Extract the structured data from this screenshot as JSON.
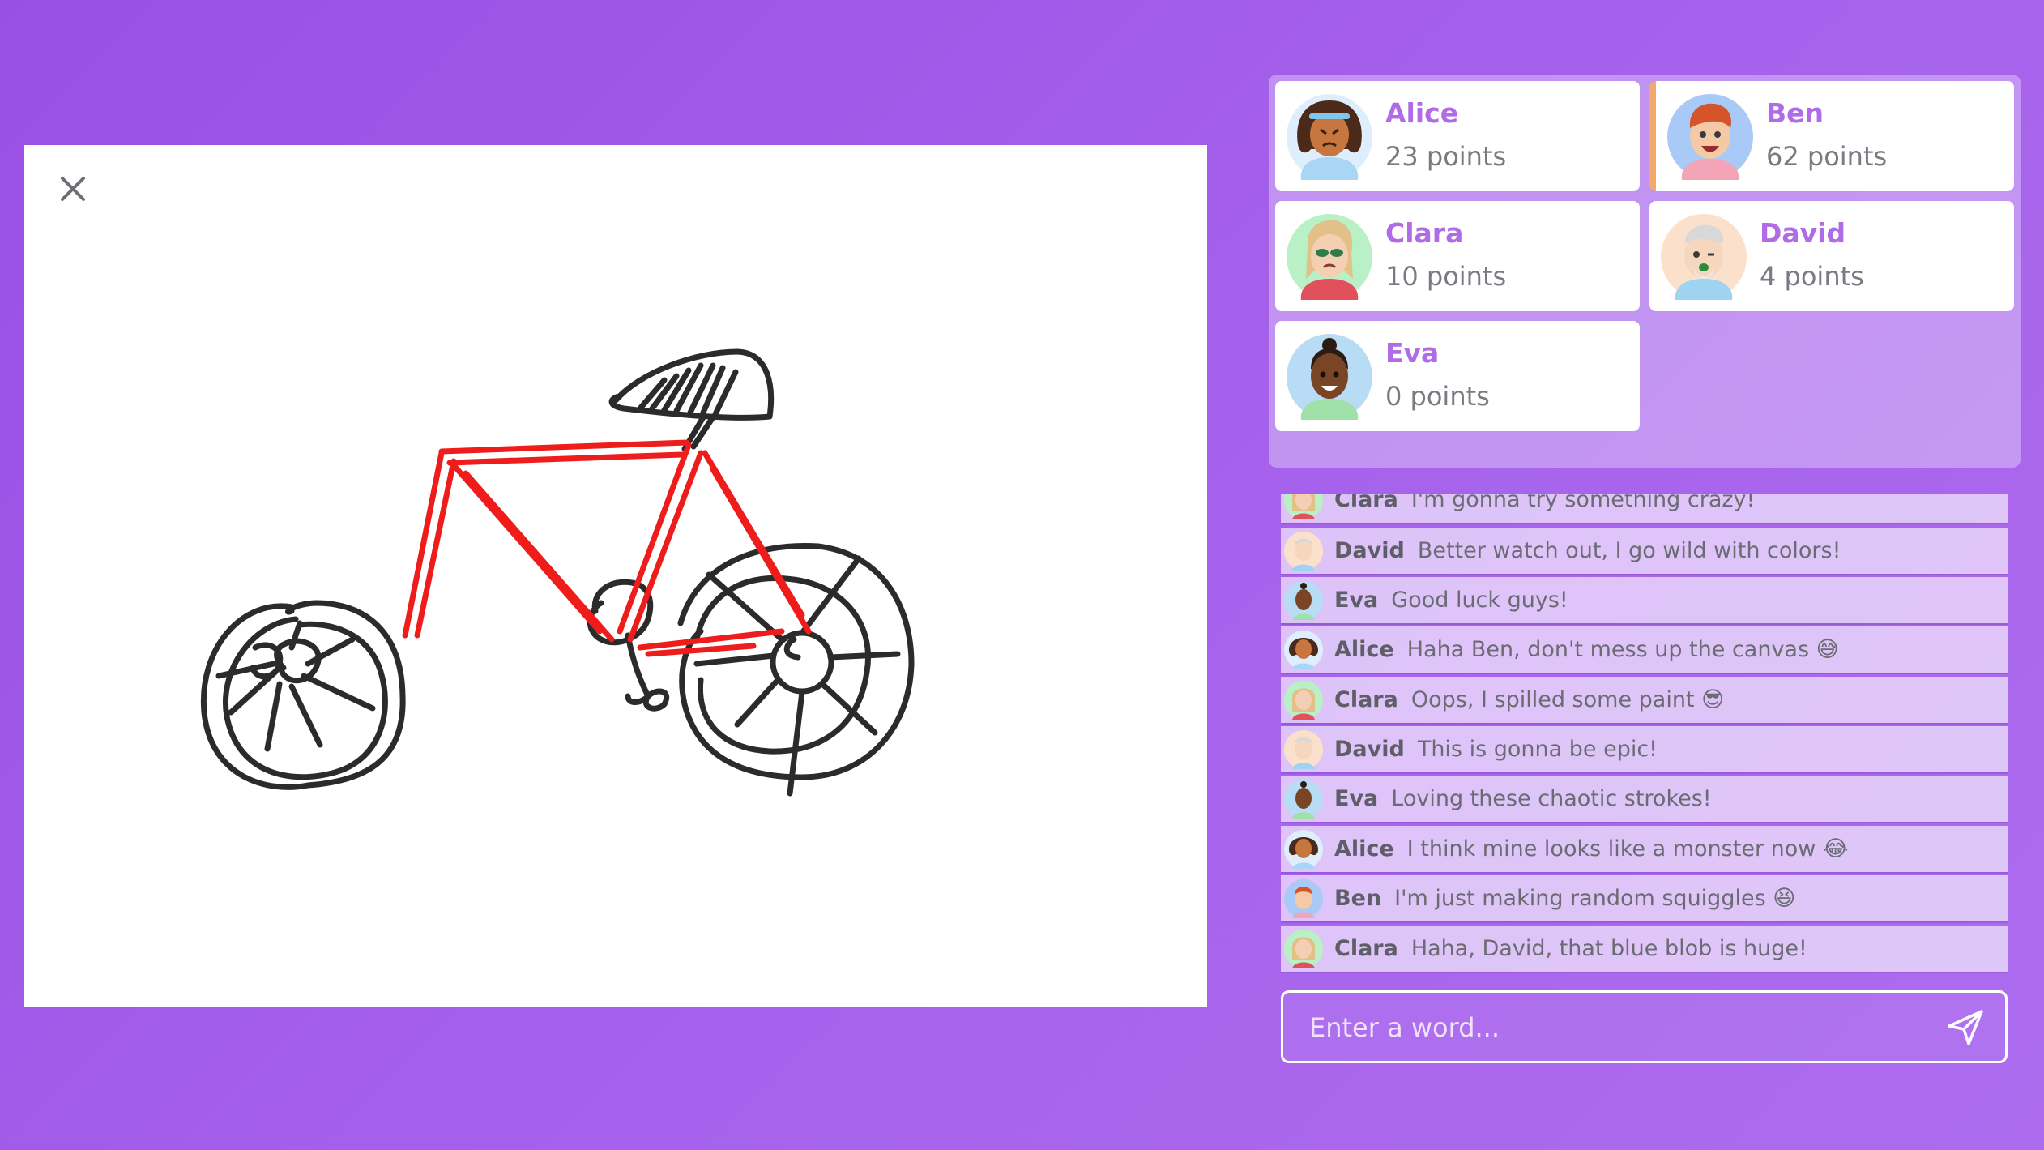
{
  "canvas": {
    "close_icon": "close-icon"
  },
  "players": [
    {
      "name": "Alice",
      "points": "23 points",
      "avatar": "avatar-alice",
      "skin": "#c7763f",
      "hair": "#4b2a1a",
      "bg": "#dfeefc",
      "shirt": "#a9d6f5"
    },
    {
      "name": "Ben",
      "points": "62 points",
      "avatar": "avatar-ben",
      "skin": "#f4c9a6",
      "hair": "#d5542a",
      "bg": "#a9c9f6",
      "shirt": "#f3a5b7"
    },
    {
      "name": "Clara",
      "points": "10 points",
      "avatar": "avatar-clara",
      "skin": "#f3d0b4",
      "hair": "#e3c08a",
      "bg": "#b9f0c6",
      "shirt": "#e2505c"
    },
    {
      "name": "David",
      "points": "4 points",
      "avatar": "avatar-david",
      "skin": "#f6d6bd",
      "hair": "#d8d8d8",
      "bg": "#fbe1cb",
      "shirt": "#9ed3f2"
    },
    {
      "name": "Eva",
      "points": "0 points",
      "avatar": "avatar-eva",
      "skin": "#7a4524",
      "hair": "#2b1b12",
      "bg": "#b9dcf6",
      "shirt": "#9fe1a8"
    }
  ],
  "chat": [
    {
      "name": "Clara",
      "text": "I'm gonna try something crazy!"
    },
    {
      "name": "David",
      "text": "Better watch out, I go wild with colors!"
    },
    {
      "name": "Eva",
      "text": "Good luck guys!"
    },
    {
      "name": "Alice",
      "text": "Haha Ben, don't mess up the canvas 😅"
    },
    {
      "name": "Clara",
      "text": "Oops, I spilled some paint 😎"
    },
    {
      "name": "David",
      "text": "This is gonna be epic!"
    },
    {
      "name": "Eva",
      "text": "Loving these chaotic strokes!"
    },
    {
      "name": "Alice",
      "text": "I think mine looks like a monster now 😂"
    },
    {
      "name": "Ben",
      "text": "I'm just making random squiggles 😆"
    },
    {
      "name": "Clara",
      "text": "Haha, David, that blue blob is huge!"
    }
  ],
  "input": {
    "placeholder": "Enter a word...",
    "value": "",
    "send_icon": "send-icon"
  },
  "colors": {
    "accent": "#b06be6",
    "brand_bg": "#9a4fe4",
    "active_marker": "#f3a96b",
    "stroke_red": "#ef1c1c",
    "stroke_dark": "#2b2b2b"
  }
}
